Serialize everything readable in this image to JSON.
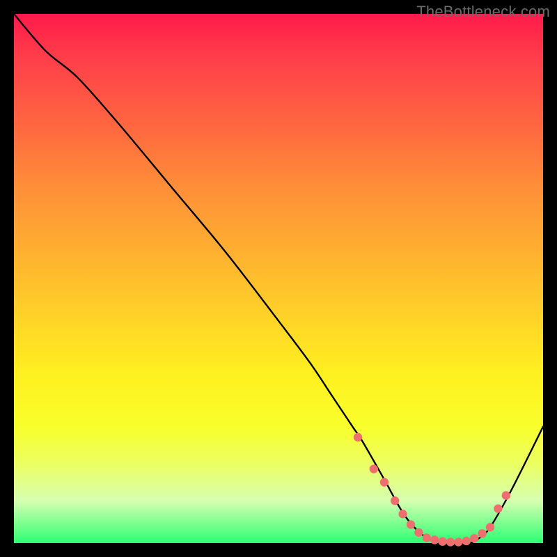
{
  "watermark": "TheBottleneck.com",
  "chart_data": {
    "type": "line",
    "title": "",
    "xlabel": "",
    "ylabel": "",
    "xlim": [
      0,
      100
    ],
    "ylim": [
      0,
      100
    ],
    "series": [
      {
        "name": "curve",
        "x": [
          0,
          6,
          12,
          20,
          30,
          40,
          50,
          56,
          60,
          64,
          66,
          70,
          74,
          78,
          82,
          86,
          88,
          90,
          94,
          100
        ],
        "y": [
          100,
          93,
          88,
          79,
          67,
          55,
          42,
          34,
          28,
          22,
          19,
          12,
          5,
          1,
          0,
          0,
          1,
          3,
          10,
          22
        ]
      }
    ],
    "markers": {
      "name": "highlighted-points",
      "color": "#ef6f6f",
      "x": [
        65,
        68,
        70,
        72,
        73.5,
        75,
        76.5,
        78,
        79.5,
        81,
        82.5,
        84,
        85.5,
        87,
        88.5,
        90,
        91.5,
        93
      ],
      "y": [
        20,
        14,
        11.5,
        8,
        5.5,
        3.5,
        2,
        1,
        0.6,
        0.3,
        0.2,
        0.2,
        0.4,
        0.9,
        1.8,
        3,
        6.5,
        9
      ]
    },
    "background_gradient": {
      "top": "#ff1a4b",
      "mid": "#fff020",
      "bottom": "#2cff72"
    }
  }
}
